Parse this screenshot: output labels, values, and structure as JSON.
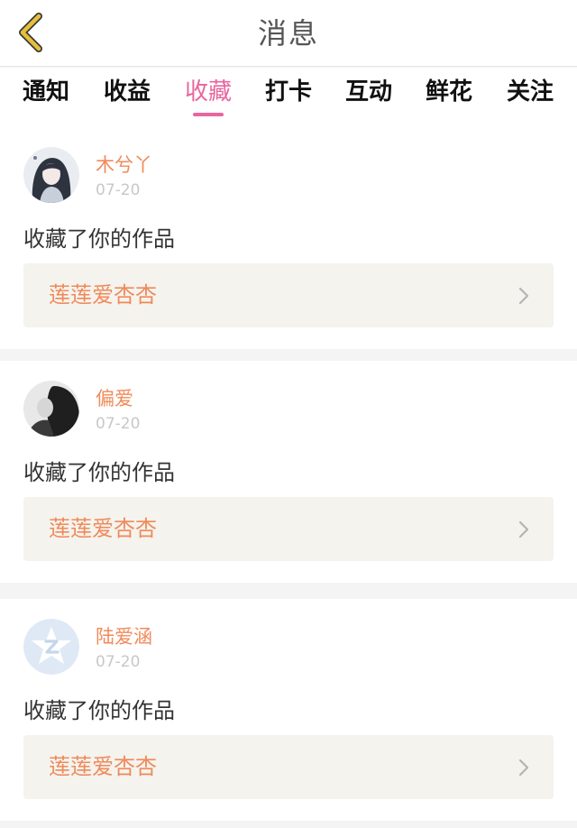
{
  "header": {
    "title": "消息",
    "back_icon": "chevron-left-icon",
    "back_color": "#e5c03a"
  },
  "tabs": [
    {
      "label": "通知",
      "active": false
    },
    {
      "label": "收益",
      "active": false
    },
    {
      "label": "收藏",
      "active": true
    },
    {
      "label": "打卡",
      "active": false
    },
    {
      "label": "互动",
      "active": false
    },
    {
      "label": "鲜花",
      "active": false
    },
    {
      "label": "关注",
      "active": false
    }
  ],
  "accent_color": "#e8659e",
  "name_color": "#f08a5a",
  "notifications": [
    {
      "username": "木兮丫",
      "date": "07-20",
      "action": "收藏了你的作品",
      "work_title": "莲莲爱杏杏",
      "avatar": "illustrated-girl"
    },
    {
      "username": "偏爱",
      "date": "07-20",
      "action": "收藏了你的作品",
      "work_title": "莲莲爱杏杏",
      "avatar": "grayscale-photo"
    },
    {
      "username": "陆爱涵",
      "date": "07-20",
      "action": "收藏了你的作品",
      "work_title": "莲莲爱杏杏",
      "avatar": "default-star-z"
    }
  ]
}
